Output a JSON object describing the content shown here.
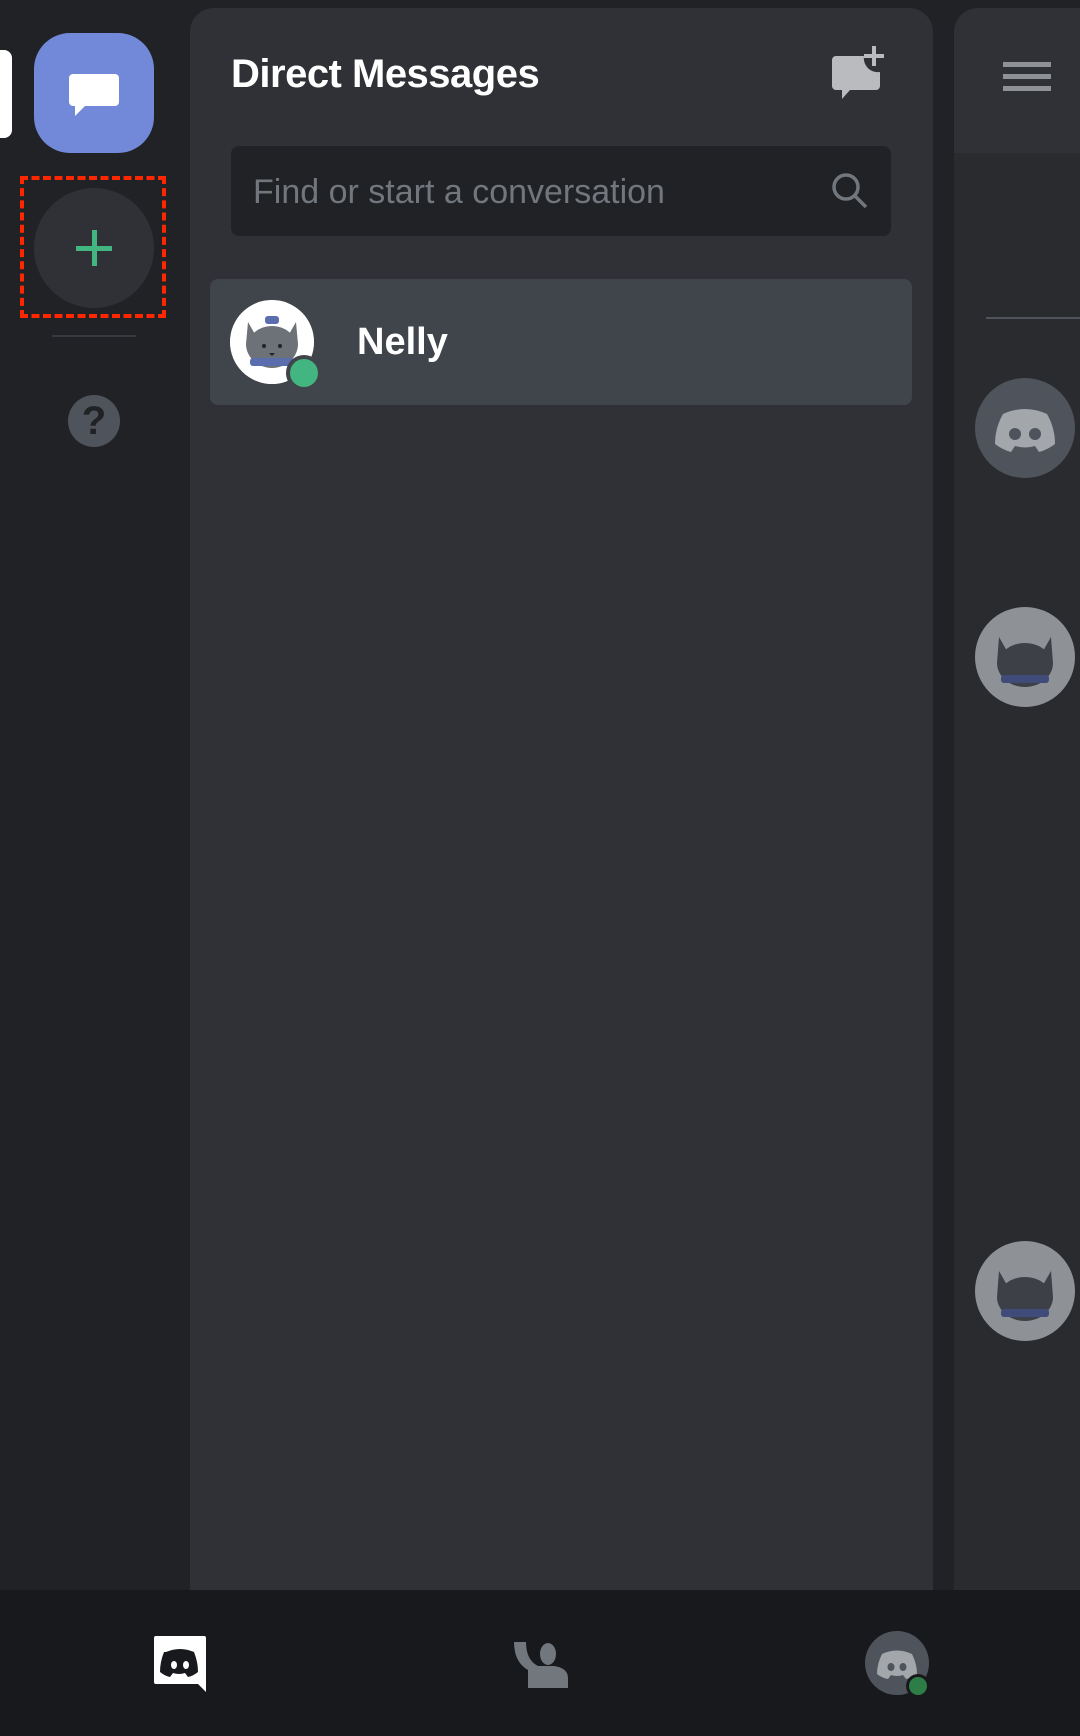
{
  "server_rail": {
    "home_button": {
      "icon": "dm-chat-bubble-icon",
      "color": "#7289da"
    },
    "add_server_button": {
      "icon": "plus-icon",
      "color": "#43b581"
    },
    "help_button": {
      "icon": "question-mark-icon",
      "glyph": "?"
    }
  },
  "dm_panel": {
    "title": "Direct Messages",
    "new_dm_icon": "new-dm-icon",
    "search": {
      "placeholder": "Find or start a conversation",
      "value": ""
    },
    "conversations": [
      {
        "name": "Nelly",
        "status": "online",
        "status_color": "#43b581",
        "selected": true
      }
    ]
  },
  "right_panel": {
    "menu_icon": "hamburger-icon",
    "members": [
      {
        "avatar": "discord-default-avatar"
      },
      {
        "avatar": "cat-avatar"
      },
      {
        "avatar": "cat-avatar"
      }
    ]
  },
  "bottom_nav": {
    "items": [
      {
        "name": "home",
        "icon": "discord-home-icon",
        "active": true
      },
      {
        "name": "friends",
        "icon": "friends-wave-icon",
        "active": false
      },
      {
        "name": "profile",
        "icon": "user-avatar-icon",
        "active": false,
        "status": "online"
      }
    ]
  },
  "colors": {
    "blurple": "#7289da",
    "green": "#43b581",
    "highlight": "#ff2600"
  }
}
